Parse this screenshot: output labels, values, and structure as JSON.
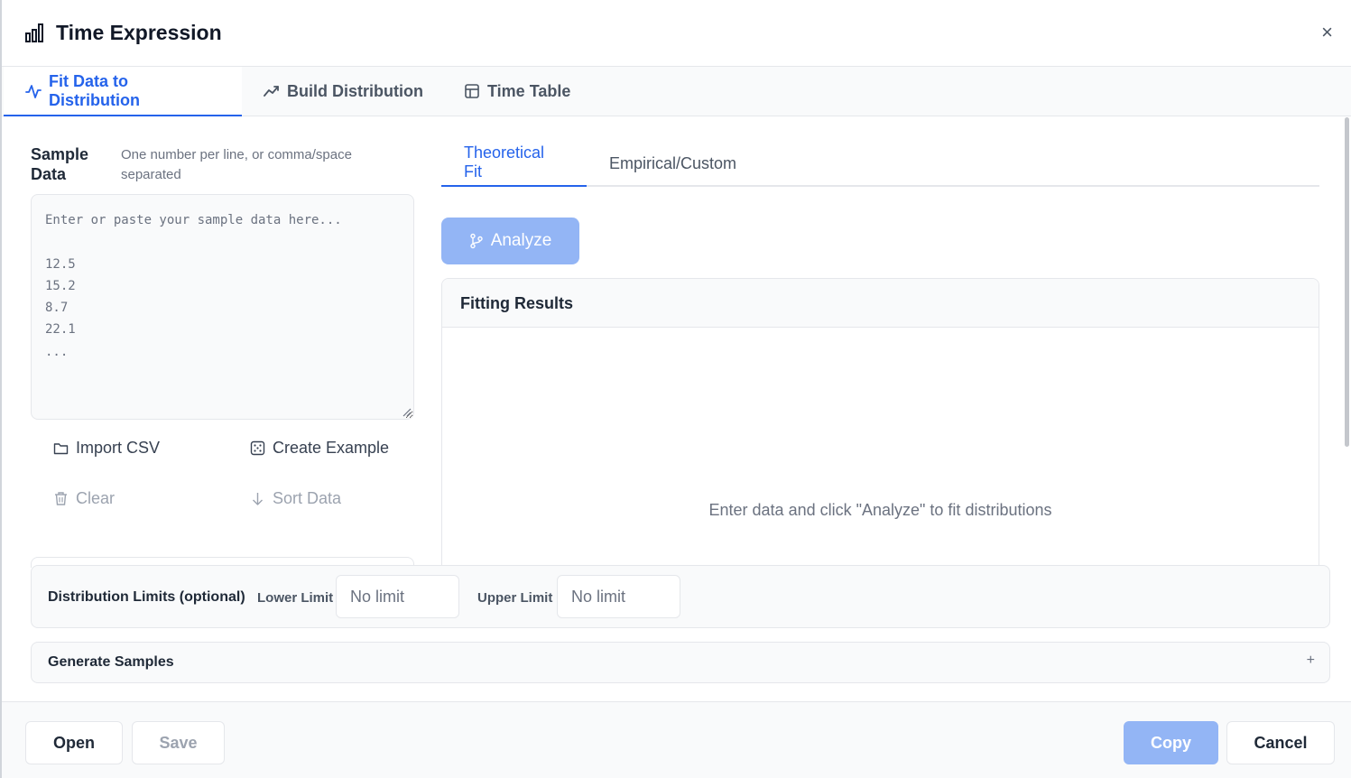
{
  "window": {
    "title": "Time Expression",
    "close_glyph": "×"
  },
  "tabs": [
    {
      "label": "Fit Data to Distribution",
      "icon": "activity-icon",
      "active": true
    },
    {
      "label": "Build Distribution",
      "icon": "trending-up-icon",
      "active": false
    },
    {
      "label": "Time Table",
      "icon": "table-icon",
      "active": false
    }
  ],
  "sample": {
    "label": "Sample Data",
    "hint": "One number per line, or comma/space separated",
    "placeholder": "Enter or paste your sample data here...\n\n12.5\n15.2\n8.7\n22.1\n..."
  },
  "actions": {
    "import_csv": "Import CSV",
    "create_example": "Create Example",
    "clear": "Clear",
    "sort_data": "Sort Data"
  },
  "subtabs": [
    {
      "label": "Theoretical Fit",
      "active": true
    },
    {
      "label": "Empirical/Custom",
      "active": false
    }
  ],
  "analyze": {
    "label": "Analyze"
  },
  "results": {
    "title": "Fitting Results",
    "empty_message": "Enter data and click \"Analyze\" to fit distributions"
  },
  "limits": {
    "title": "Distribution Limits (optional)",
    "lower_label": "Lower Limit",
    "lower_placeholder": "No limit",
    "upper_label": "Upper Limit",
    "upper_placeholder": "No limit"
  },
  "generate": {
    "title": "Generate Samples",
    "toggle_glyph": "+"
  },
  "footer": {
    "open": "Open",
    "save": "Save",
    "copy": "Copy",
    "cancel": "Cancel"
  },
  "colors": {
    "accent": "#2563eb",
    "primary_disabled": "#93b5f5",
    "border": "#e5e7eb"
  }
}
